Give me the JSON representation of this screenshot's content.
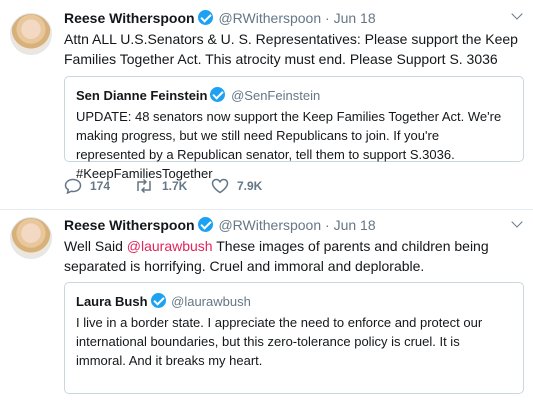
{
  "tweets": [
    {
      "name": "Reese Witherspoon",
      "handle": "@RWitherspoon",
      "separator": "·",
      "date": "Jun 18",
      "text": "Attn ALL U.S.Senators & U. S. Representatives: Please support the Keep Families Together Act. This atrocity must end. Please Support S. 3036",
      "quote": {
        "name": "Sen Dianne Feinstein",
        "handle": "@SenFeinstein",
        "text": "UPDATE: 48 senators now support the Keep Families Together Act. We're making progress, but we still need Republicans to join. If you're represented by a Republican senator, tell them to support S.3036. #KeepFamiliesTogether"
      },
      "actions": {
        "replies": "174",
        "retweets": "1.7K",
        "likes": "7.9K"
      }
    },
    {
      "name": "Reese Witherspoon",
      "handle": "@RWitherspoon",
      "separator": "·",
      "date": "Jun 18",
      "text_prefix": "Well Said ",
      "mention": "@laurawbush",
      "text_suffix": " These images of parents and children being separated is horrifying. Cruel and immoral and deplorable.",
      "quote": {
        "name": "Laura Bush",
        "handle": "@laurawbush",
        "text": "I live in a border state. I appreciate the need to enforce and protect our international boundaries, but this zero-tolerance policy is cruel. It is immoral. And it breaks my heart."
      }
    }
  ],
  "colors": {
    "verified": "#1da1f2",
    "mention": "#e0245e",
    "muted": "#657786"
  },
  "icons": {
    "reply": "reply-icon",
    "retweet": "retweet-icon",
    "like": "heart-icon",
    "menu": "chevron-down-icon",
    "verified": "verified-badge-icon"
  }
}
